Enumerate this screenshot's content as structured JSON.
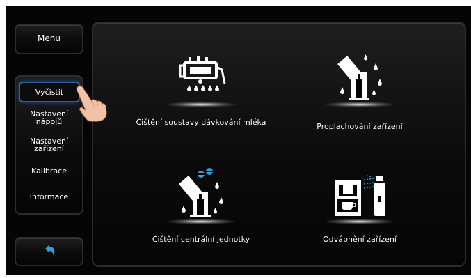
{
  "sidebar": {
    "menu_label": "Menu",
    "items": [
      {
        "label": "Vyčistit",
        "active": true
      },
      {
        "label": "Nastavení nápojů",
        "active": false
      },
      {
        "label": "Nastavení zařízení",
        "active": false
      },
      {
        "label": "Kalibrace",
        "active": false
      },
      {
        "label": "Informace",
        "active": false
      }
    ],
    "back_icon": "back-arrow-icon"
  },
  "main": {
    "tiles": [
      {
        "icon": "milk-system-cleaning-icon",
        "label": "Čištění soustavy dávkování mléka"
      },
      {
        "icon": "device-rinsing-icon",
        "label": "Proplachování zařízení"
      },
      {
        "icon": "brew-unit-cleaning-icon",
        "label": "Čištění centrální jednotky"
      },
      {
        "icon": "descaling-icon",
        "label": "Odvápnění zařízení"
      }
    ]
  },
  "colors": {
    "background": "#050505",
    "accent_blue": "#2b5fa0",
    "icon_blue": "#3a9ad9",
    "text": "#ffffff"
  }
}
